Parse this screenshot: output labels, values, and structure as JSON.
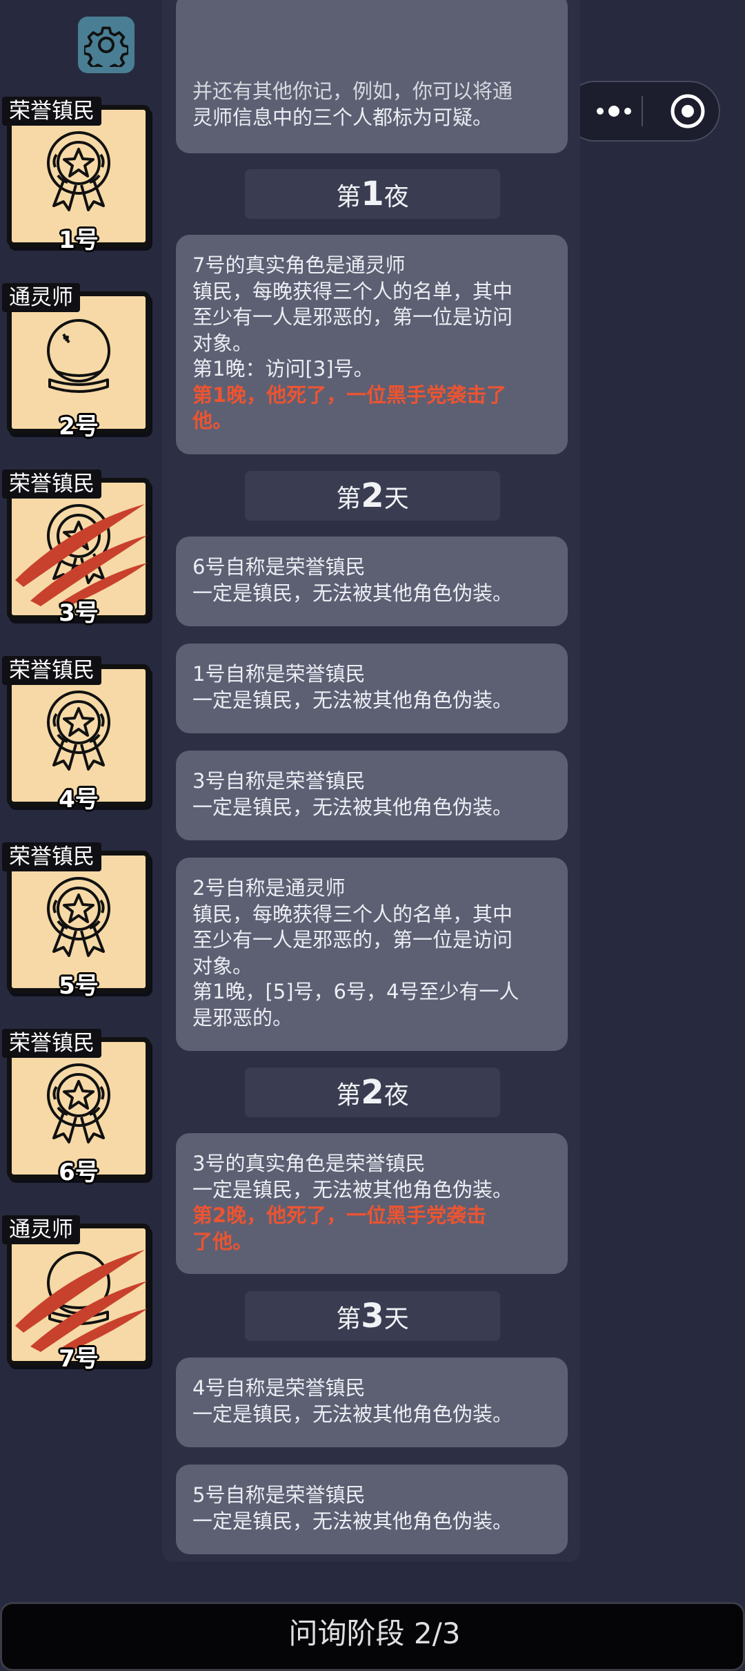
{
  "players": [
    {
      "role": "荣誉镇民",
      "number": "1号",
      "icon": "medal-icon",
      "dead": false
    },
    {
      "role": "通灵师",
      "number": "2号",
      "icon": "crystal-ball-icon",
      "dead": false
    },
    {
      "role": "荣誉镇民",
      "number": "3号",
      "icon": "medal-icon",
      "dead": true
    },
    {
      "role": "荣誉镇民",
      "number": "4号",
      "icon": "medal-icon",
      "dead": false
    },
    {
      "role": "荣誉镇民",
      "number": "5号",
      "icon": "medal-icon",
      "dead": false
    },
    {
      "role": "荣誉镇民",
      "number": "6号",
      "icon": "medal-icon",
      "dead": false
    },
    {
      "role": "通灵师",
      "number": "7号",
      "icon": "crystal-ball-icon",
      "dead": true
    }
  ],
  "log": {
    "entry0": {
      "line1": "并还有其他你记，例如，你可以将通",
      "line2": "灵师信息中的三个人都标为可疑。"
    },
    "phase1": {
      "prefix": "第",
      "num": "1",
      "suffix": "夜"
    },
    "entry1": {
      "line1": "7号的真实角色是通灵师",
      "line2": "镇民，每晚获得三个人的名单，其中",
      "line3": "至少有一人是邪恶的，第一位是访问",
      "line4": "对象。",
      "line5": "第1晚：访问[3]号。",
      "alert1": "第1晚，他死了，一位黑手党袭击了",
      "alert2": "他。"
    },
    "phase2": {
      "prefix": "第",
      "num": "2",
      "suffix": "天"
    },
    "entry2": {
      "line1": "6号自称是荣誉镇民",
      "line2": "一定是镇民，无法被其他角色伪装。"
    },
    "entry3": {
      "line1": "1号自称是荣誉镇民",
      "line2": "一定是镇民，无法被其他角色伪装。"
    },
    "entry4": {
      "line1": "3号自称是荣誉镇民",
      "line2": "一定是镇民，无法被其他角色伪装。"
    },
    "entry5": {
      "line1": "2号自称是通灵师",
      "line2": "镇民，每晚获得三个人的名单，其中",
      "line3": "至少有一人是邪恶的，第一位是访问",
      "line4": "对象。",
      "line5": "第1晚，[5]号，6号，4号至少有一人",
      "line6": "是邪恶的。"
    },
    "phase3": {
      "prefix": "第",
      "num": "2",
      "suffix": "夜"
    },
    "entry6": {
      "line1": "3号的真实角色是荣誉镇民",
      "line2": "一定是镇民，无法被其他角色伪装。",
      "alert1": "第2晚，他死了，一位黑手党袭击",
      "alert2": "了他。"
    },
    "phase4": {
      "prefix": "第",
      "num": "3",
      "suffix": "天"
    },
    "entry7": {
      "line1": "4号自称是荣誉镇民",
      "line2": "一定是镇民，无法被其他角色伪装。"
    },
    "entry8": {
      "line1": "5号自称是荣誉镇民",
      "line2": "一定是镇民，无法被其他角色伪装。"
    }
  },
  "footer": {
    "stage_label": "问询阶段 2/3"
  },
  "toolbar": {
    "settings_icon": "gear-icon",
    "more_icon": "more-dots-icon",
    "close_icon": "target-circle-icon"
  },
  "colors": {
    "background": "#272a3e",
    "card": "#f6d9a6",
    "log_bubble": "#5d6073",
    "alert_text": "#ec5431",
    "claw": "#c8412c"
  }
}
